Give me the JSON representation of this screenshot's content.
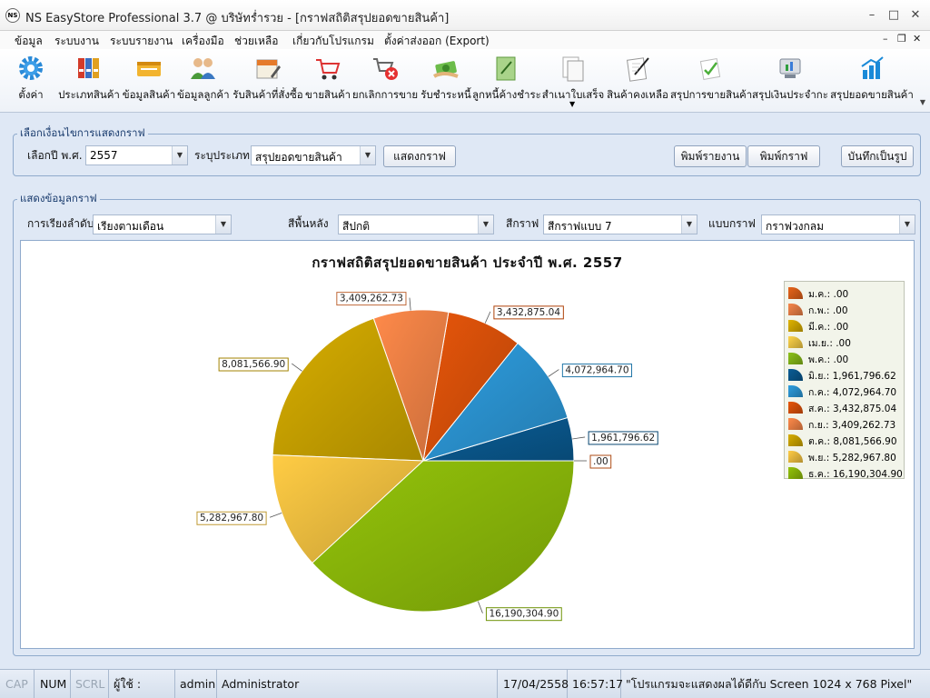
{
  "window": {
    "title": "NS EasyStore Professional 3.7 @ บริษัทร่ำรวย - [กราฟสถิติสรุปยอดขายสินค้า]",
    "icon_text": "NS"
  },
  "menu": [
    "ข้อมูล",
    "ระบบงาน",
    "ระบบรายงาน",
    "เครื่องมือ",
    "ช่วยเหลือ",
    "เกี่ยวกับโปรแกรม",
    "ตั้งค่าส่งออก (Export)"
  ],
  "toolbar": [
    {
      "label": "ตั้งค่า",
      "icon": "gear-icon"
    },
    {
      "label": "ประเภทสินค้า",
      "icon": "binders-icon"
    },
    {
      "label": "ข้อมูลสินค้า",
      "icon": "product-box-icon"
    },
    {
      "label": "ข้อมูลลูกค้า",
      "icon": "customers-icon"
    },
    {
      "label": "รับสินค้าที่สั่งซื้อ",
      "icon": "receive-goods-icon"
    },
    {
      "label": "ขายสินค้า",
      "icon": "shopping-cart-icon"
    },
    {
      "label": "ยกเลิกการขาย",
      "icon": "cancel-cart-icon"
    },
    {
      "label": "รับชำระหนี้",
      "icon": "payment-icon"
    },
    {
      "label": "ลูกหนี้ค้างชำระ",
      "icon": "debtor-icon"
    },
    {
      "label": "สำเนาใบเสร็จ",
      "icon": "copy-receipt-icon"
    },
    {
      "label": "สินค้าคงเหลือ",
      "icon": "stock-icon"
    },
    {
      "label": "สรุปการขายสินค้า",
      "icon": "sales-summary-icon"
    },
    {
      "label": "สรุปเงินประจำกะ",
      "icon": "shift-summary-icon"
    },
    {
      "label": "สรุปยอดขายสินค้า",
      "icon": "bar-chart-icon"
    }
  ],
  "options": {
    "legend": "เลือกเงื่อนไขการแสดงกราฟ",
    "year_label": "เลือกปี พ.ศ.",
    "year_value": "2557",
    "type_label": "ระบุประเภท",
    "type_value": "สรุปยอดขายสินค้า",
    "show_button": "แสดงกราฟ",
    "print_report_button": "พิมพ์รายงาน",
    "print_chart_button": "พิมพ์กราฟ",
    "save_image_button": "บันทึกเป็นรูป"
  },
  "display": {
    "legend": "แสดงข้อมูลกราฟ",
    "sort_label": "การเรียงลำดับ",
    "sort_value": "เรียงตามเดือน",
    "bg_label": "สีพื้นหลัง",
    "bg_value": "สีปกติ",
    "color_label": "สีกราฟ",
    "color_value": "สีกราฟแบบ 7",
    "chart_type_label": "แบบกราฟ",
    "chart_type_value": "กราฟวงกลม"
  },
  "chart_data": {
    "type": "pie",
    "title": "กราฟสถิติสรุปยอดขายสินค้า  ประจำปี  พ.ศ. 2557",
    "legend_position": "right",
    "slices": [
      {
        "label": "ม.ค.",
        "value": 0,
        "value_text": ".00",
        "color": "#e8641a"
      },
      {
        "label": "ก.พ.",
        "value": 0,
        "value_text": ".00",
        "color": "#f7864a"
      },
      {
        "label": "มี.ค.",
        "value": 0,
        "value_text": ".00",
        "color": "#e0b400"
      },
      {
        "label": "เม.ย.",
        "value": 0,
        "value_text": ".00",
        "color": "#ffd54a"
      },
      {
        "label": "พ.ค.",
        "value": 0,
        "value_text": ".00",
        "color": "#8cc21a"
      },
      {
        "label": "มิ.ย.",
        "value": 1961796.62,
        "value_text": "1,961,796.62",
        "color": "#0a5d96"
      },
      {
        "label": "ก.ค.",
        "value": 4072964.7,
        "value_text": "4,072,964.70",
        "color": "#2e9ee0"
      },
      {
        "label": "ส.ค.",
        "value": 3432875.04,
        "value_text": "3,432,875.04",
        "color": "#e8560a"
      },
      {
        "label": "ก.ย.",
        "value": 3409262.73,
        "value_text": "3,409,262.73",
        "color": "#ff8a4a"
      },
      {
        "label": "ต.ค.",
        "value": 8081566.9,
        "value_text": "8,081,566.90",
        "color": "#d8ae00"
      },
      {
        "label": "พ.ย.",
        "value": 5282967.8,
        "value_text": "5,282,967.80",
        "color": "#ffcc44"
      },
      {
        "label": "ธ.ค.",
        "value": 16190304.9,
        "value_text": "16,190,304.90",
        "color": "#94c40a"
      }
    ]
  },
  "status": {
    "cap": "CAP",
    "num": "NUM",
    "scrl": "SCRL",
    "user_label": "ผู้ใช้   :",
    "user_name": "admin",
    "user_role": "Administrator",
    "date": "17/04/2558",
    "time": "16:57:17",
    "message": "\"โปรแกรมจะแสดงผลได้ดีกับ  Screen 1024 x 768 Pixel\""
  }
}
